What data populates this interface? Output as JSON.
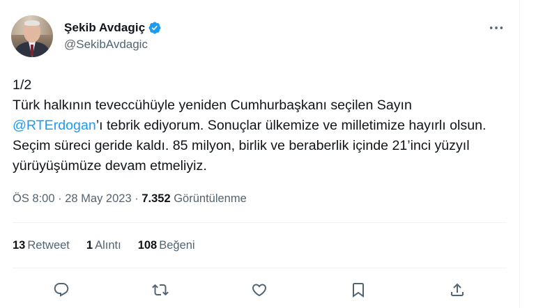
{
  "author": {
    "display_name": "Şekib Avdagiç",
    "handle": "@SekibAvdagic",
    "verified_icon": "verified-badge-icon"
  },
  "tweet": {
    "thread_index": "1/2",
    "text_part1": "Türk halkının teveccühüyle yeniden Cumhurbaşkanı seçilen Sayın",
    "mention": "@RTErdogan",
    "text_part2": "’ı tebrik ediyorum. Sonuçlar ülkemize ve milletimize hayırlı olsun. Seçim süreci geride kaldı. 85 milyon, birlik ve beraberlik içinde 21’inci yüzyıl yürüyüşümüze devam etmeliyiz."
  },
  "meta": {
    "time": "ÖS 8:00",
    "separator": "·",
    "date": "28 May 2023",
    "views_count": "7.352",
    "views_label": "Görüntülenme"
  },
  "stats": {
    "retweets_count": "13",
    "retweets_label": "Retweet",
    "quotes_count": "1",
    "quotes_label": "Alıntı",
    "likes_count": "108",
    "likes_label": "Beğeni"
  },
  "actions": [
    "reply-icon",
    "retweet-icon",
    "like-icon",
    "bookmark-icon",
    "share-icon"
  ],
  "colors": {
    "accent": "#1d9bf0",
    "secondary_text": "#536471",
    "primary_text": "#0f1419"
  }
}
